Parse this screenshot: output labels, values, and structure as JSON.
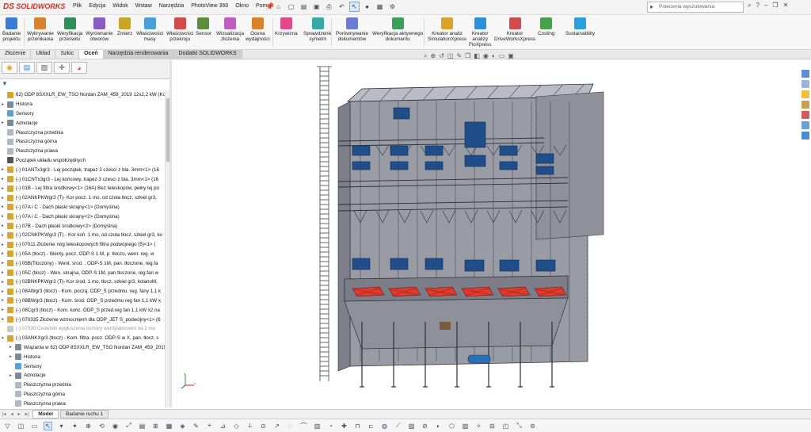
{
  "app": {
    "logo_text": "SOLIDWORKS",
    "logo_mark": "DS"
  },
  "menu": [
    "Plik",
    "Edycja",
    "Widok",
    "Wstaw",
    "Narzędzia",
    "PhotoView 360",
    "Okno",
    "Pomoc"
  ],
  "search": {
    "placeholder": "Polecenia wyszukiwania"
  },
  "ribbon": [
    {
      "label": "Badanie\nprojektu",
      "color": "#3a7bd5"
    },
    {
      "label": "Wykrywanie\nprzenikania",
      "color": "#d9822b"
    },
    {
      "label": "Weryfikacja\nprześwitu",
      "color": "#2f8f5b"
    },
    {
      "label": "Wyrównanie\notworów",
      "color": "#8a5cc2"
    },
    {
      "label": "Zmierz",
      "color": "#c8a42b"
    },
    {
      "label": "Właściwości\nmasy",
      "color": "#4a9fd8"
    },
    {
      "label": "Właściwości\nprzekroju",
      "color": "#d24b4b"
    },
    {
      "label": "Sensor",
      "color": "#5a8f3a"
    },
    {
      "label": "Wizualizacja\nzłożenia",
      "color": "#c25cc2"
    },
    {
      "label": "Ocena\nwydajności",
      "color": "#d9822b"
    },
    {
      "label": "Krzywizna",
      "color": "#e04a8a"
    },
    {
      "label": "Sprawdzenie\nsymetrii",
      "color": "#3aa8a8"
    },
    {
      "label": "Porównywanie\ndokumentów",
      "color": "#6a7bd5"
    },
    {
      "label": "Weryfikacja aktywnego\ndokumentu",
      "color": "#3a9f5b"
    },
    {
      "label": "Kreator analiz\nSimulationXpress",
      "color": "#d9a32b"
    },
    {
      "label": "Kreator\nanalizy\nFloXpress",
      "color": "#2b8fd9"
    },
    {
      "label": "Kreator\nDriveWorksXpress",
      "color": "#d24b4b"
    },
    {
      "label": "Costing",
      "color": "#4aa04a"
    },
    {
      "label": "Sustainability",
      "color": "#2b9fd9"
    }
  ],
  "cm_tabs": [
    "Złożenie",
    "Układ",
    "Szkic",
    "Oceń",
    "Narzędzia renderowania",
    "Dodatki SOLIDWORKS"
  ],
  "active_cm_tab": "Oceń",
  "tree": [
    {
      "label": "62) ODP 8SXXLR_EW_TSO Nordan ZAM_459_2019 12x2,2 kW  (Komple",
      "color": "#d6a630",
      "arrow": ""
    },
    {
      "label": "Historia",
      "color": "#7a8a99",
      "arrow": "▸"
    },
    {
      "label": "Sensory",
      "color": "#5a9fd8",
      "arrow": ""
    },
    {
      "label": "Adnotacje",
      "color": "#7a8a99",
      "arrow": "▸"
    },
    {
      "label": "Płaszczyzna przednia",
      "color": "#b0b8c4",
      "arrow": ""
    },
    {
      "label": "Płaszczyzna górna",
      "color": "#b0b8c4",
      "arrow": ""
    },
    {
      "label": "Płaszczyzna prawa",
      "color": "#b0b8c4",
      "arrow": ""
    },
    {
      "label": "Początek układu współrzędnych",
      "color": "#555555",
      "arrow": ""
    },
    {
      "label": "(-) 01ANTx3gr3 - Lej początek, trapez 3 czesci z bla. 3mm<1> (16",
      "color": "#d6a630",
      "arrow": "▸"
    },
    {
      "label": "(-) 01CNTx3gr3 - Lej końcowy, trapez 3 czesci z bla. 3mm<1> (16",
      "color": "#d6a630",
      "arrow": "▸"
    },
    {
      "label": "(-) 01B - Lej filtra środkowy<1> (16A) Bez teleskopów, pełny lej po",
      "color": "#d6a630",
      "arrow": "▸"
    },
    {
      "label": "(-) 02ANKPKWgr3 (T)- Kor pocz. 1 mo, od czoła tłocz, szkiel gr3,",
      "color": "#d6a630",
      "arrow": "▸"
    },
    {
      "label": "(-) 07A i C - Dach płaski skrajny<1> (Domyślna)",
      "color": "#d6a630",
      "arrow": "▸"
    },
    {
      "label": "(-) 07A i C - Dach płaski skrajny<2> (Domyślna)",
      "color": "#d6a630",
      "arrow": "▸"
    },
    {
      "label": "(-) 07B - Dach płaski środkowy<2> (Domyślna)",
      "color": "#d6a630",
      "arrow": "▸"
    },
    {
      "label": "(-) 02CNKPKWgr3 (T) - Kor koń. 1 mo, od czoła tłocz, szkiel gr3, ko",
      "color": "#d6a630",
      "arrow": "▸"
    },
    {
      "label": "(-) 07011 Złożenie nóg teleskopowych filtra podwójnego (5)<1> (",
      "color": "#d6a630",
      "arrow": "▸"
    },
    {
      "label": "(-) 05A (tłocz) - Wenty. pocz, ODP-S 1 M, p. tłoczo, went. reg. w",
      "color": "#d6a630",
      "arrow": "▸"
    },
    {
      "label": "(-) 05B(Tłoczony) - Went. środ. , ODP-S 1M, pan. tłoczone, reg.fa",
      "color": "#d6a630",
      "arrow": "▸"
    },
    {
      "label": "(-) 05C (tłocz) - Wen. skrajna, ODP-S 1M, pan.tłoczone, reg.fan w",
      "color": "#d6a630",
      "arrow": "▸"
    },
    {
      "label": "(-) 02BNKPKWgr3 (T)- Kor środ. 1 mo, tłocz, szkiel gr3, kolanoM, ",
      "color": "#d6a630",
      "arrow": "▸"
    },
    {
      "label": "(-) 08AWgr3 (tłocz) - Kom. począ. ODP_S przedmu. reg. fany 1,1 k",
      "color": "#d6a630",
      "arrow": "▸"
    },
    {
      "label": "(-) 08BWgr3 (tłocz) - Kom. środ. ODP_S przedmu reg fan 1,1 kW x",
      "color": "#d6a630",
      "arrow": "▸"
    },
    {
      "label": "(-) 08Cgr3 (tłocz) - Kom. końc. ODP_S przed.reg fan 1,1 kW x2 na",
      "color": "#d6a630",
      "arrow": "▸"
    },
    {
      "label": "(-) 070335 Złożenie wzmocnienń dla ODP_JET S_podwójny<1> (6",
      "color": "#d6a630",
      "arrow": "▸"
    },
    {
      "label": "(-) 07030 Ceowniki wygłuszenia komory wentylatorowni na 2 mo",
      "color": "#c8c8c8",
      "arrow": "",
      "gray": true
    },
    {
      "label": "(-) 03ANKXgr3 (tłocz) - Kom. filtra. pocz. ODP-S w X, pan. tłocz, s",
      "color": "#d6a630",
      "arrow": "▾"
    },
    {
      "label": "Wiązania w 62) ODP 8SXXLR_EW_TSO Nordan ZAM_459_2019",
      "color": "#7a8a99",
      "arrow": "▸",
      "indent": 1
    },
    {
      "label": "Historia",
      "color": "#7a8a99",
      "arrow": "▸",
      "indent": 1
    },
    {
      "label": "Sensory",
      "color": "#5a9fd8",
      "arrow": "",
      "indent": 1
    },
    {
      "label": "Adnotacje",
      "color": "#7a8a99",
      "arrow": "▸",
      "indent": 1
    },
    {
      "label": "Płaszczyzna przednia",
      "color": "#b0b8c4",
      "arrow": "",
      "indent": 1
    },
    {
      "label": "Płaszczyzna górna",
      "color": "#b0b8c4",
      "arrow": "",
      "indent": 1
    },
    {
      "label": "Płaszczyzna prawa",
      "color": "#b0b8c4",
      "arrow": "",
      "indent": 1
    }
  ],
  "bottom_tabs": [
    "Model",
    "Badanie ruchu 1"
  ],
  "active_bottom_tab": "Model",
  "triad": {
    "x": "x",
    "y": "y",
    "z": "z"
  }
}
